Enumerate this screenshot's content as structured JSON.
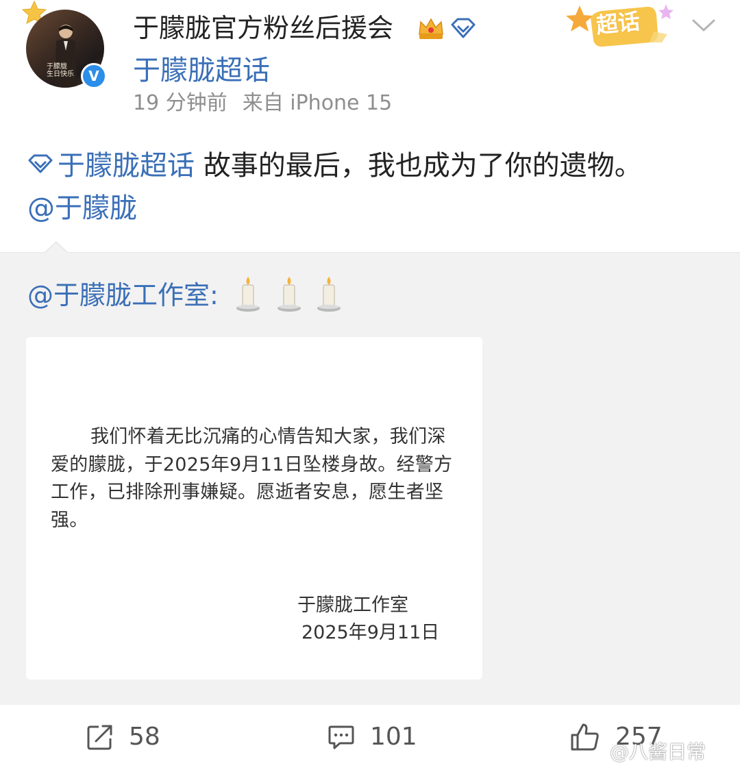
{
  "header": {
    "username": "于朦胧官方粉丝后援会",
    "supertopic_link": "于朦胧超话",
    "time": "19 分钟前",
    "source": "来自 iPhone 15",
    "badge_label": "超话",
    "avatar_caption_line1": "于朦胧",
    "avatar_caption_line2": "生日快乐",
    "verified_mark": "V"
  },
  "post": {
    "topic": "于朦胧超话",
    "text": "故事的最后，我也成为了你的遗物。",
    "mention": "@于朦胧"
  },
  "repost": {
    "author": "@于朦胧工作室:",
    "candle_icons": [
      "candle-icon",
      "candle-icon",
      "candle-icon"
    ],
    "statement": {
      "body": "我们怀着无比沉痛的心情告知大家，我们深爱的朦胧，于2025年9月11日坠楼身故。经警方工作，已排除刑事嫌疑。愿逝者安息，愿生者坚强。",
      "signature": "于朦胧工作室",
      "date": "2025年9月11日"
    }
  },
  "actions": {
    "repost_count": "58",
    "comment_count": "101",
    "like_count": "257"
  },
  "watermark": "@八酱日常",
  "colors": {
    "link": "#3a6fb7",
    "text": "#222222",
    "meta": "#8e8e8e",
    "repost_bg": "#f2f2f2",
    "verified": "#2b8ee8",
    "badge": "#f4c04c"
  }
}
